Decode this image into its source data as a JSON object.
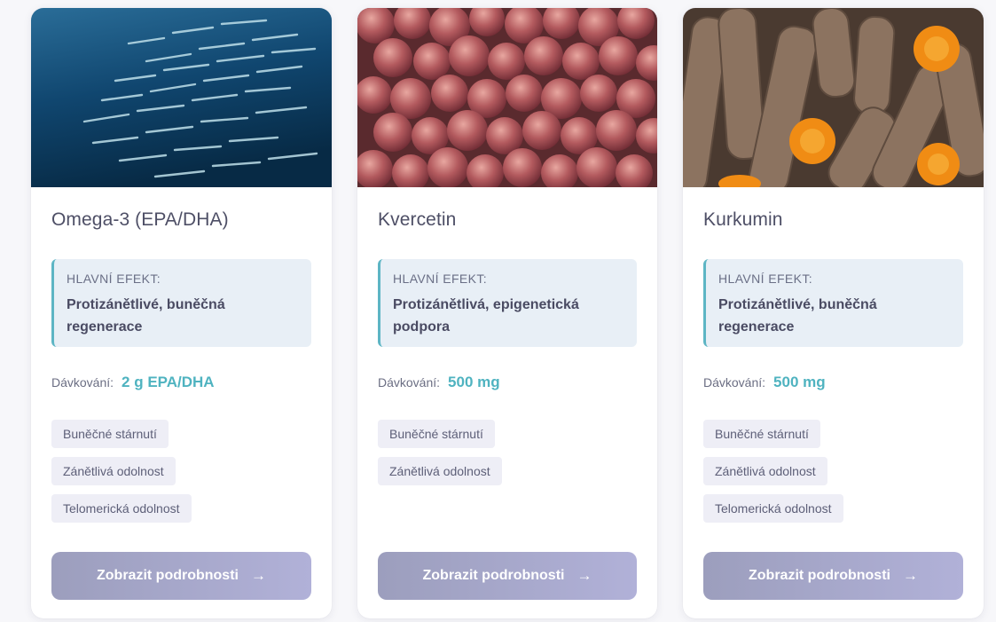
{
  "colors": {
    "accent": "#4fb3c0",
    "effect_bg": "#e8eff6",
    "button_gradient_start": "#9c9ebd",
    "button_gradient_end": "#b1b1d8"
  },
  "cards": [
    {
      "image": "fish-school-photo",
      "title": "Omega-3 (EPA/DHA)",
      "effect_label": "HLAVNÍ EFEKT:",
      "effect_text": "Protizánětlivé, buněčná regenerace",
      "dose_label": "Dávkování:",
      "dose_value": "2 g EPA/DHA",
      "tags": [
        "Buněčné stárnutí",
        "Zánětlivá odolnost",
        "Telomerická odolnost"
      ],
      "button_label": "Zobrazit podrobnosti",
      "button_icon": "arrow-right-icon"
    },
    {
      "image": "red-onions-photo",
      "title": "Kvercetin",
      "effect_label": "HLAVNÍ EFEKT:",
      "effect_text": "Protizánětlivá, epigenetická podpora",
      "dose_label": "Dávkování:",
      "dose_value": "500 mg",
      "tags": [
        "Buněčné stárnutí",
        "Zánětlivá odolnost"
      ],
      "button_label": "Zobrazit podrobnosti",
      "button_icon": "arrow-right-icon"
    },
    {
      "image": "turmeric-roots-photo",
      "title": "Kurkumin",
      "effect_label": "HLAVNÍ EFEKT:",
      "effect_text": "Protizánětlivé, buněčná regenerace",
      "dose_label": "Dávkování:",
      "dose_value": "500 mg",
      "tags": [
        "Buněčné stárnutí",
        "Zánětlivá odolnost",
        "Telomerická odolnost"
      ],
      "button_label": "Zobrazit podrobnosti",
      "button_icon": "arrow-right-icon"
    }
  ]
}
